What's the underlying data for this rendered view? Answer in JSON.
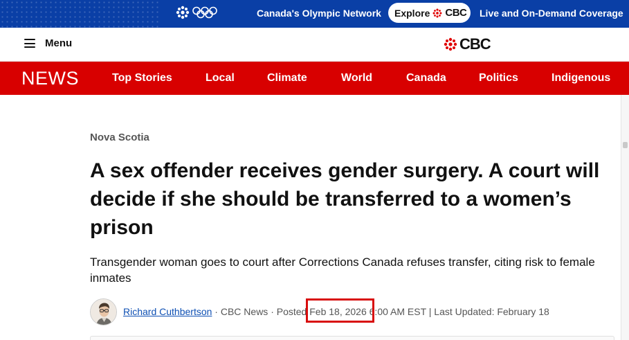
{
  "olympic_bar": {
    "network_text": "Canada's Olympic Network",
    "explore_label": "Explore",
    "explore_brand": "CBC",
    "coverage_text": "Live and On-Demand Coverage"
  },
  "header": {
    "menu_label": "Menu",
    "logo_text": "CBC"
  },
  "news_nav": {
    "brand": "NEWS",
    "items": [
      "Top Stories",
      "Local",
      "Climate",
      "World",
      "Canada",
      "Politics",
      "Indigenous"
    ]
  },
  "article": {
    "section": "Nova Scotia",
    "headline": "A sex offender receives gender surgery. A court will decide if she should be transferred to a women’s prison",
    "dek": "Transgender woman goes to court after Corrections Canada refuses transfer, citing risk to female inmates",
    "byline": {
      "author": "Richard Cuthbertson",
      "outlet": " · CBC News · Posted ",
      "posted_date": "Feb 18, 2026",
      "posted_time": " 6:00 AM EST | Last Updated: February 18"
    }
  },
  "colors": {
    "olympic_blue": "#0a3fa6",
    "cbc_red": "#d80000",
    "link_blue": "#0d4fb3",
    "highlight_red": "#d80d0d"
  },
  "icons": {
    "menu": "hamburger-icon",
    "cbc_gem": "cbc-gem-icon",
    "olympic_rings": "olympic-rings-icon",
    "author_photo": "avatar"
  }
}
